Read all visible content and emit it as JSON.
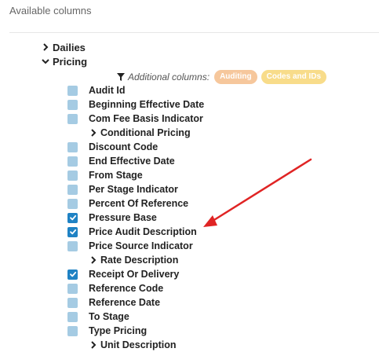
{
  "panel": {
    "title": "Available columns"
  },
  "groups": {
    "dailies": {
      "label": "Dailies"
    },
    "pricing": {
      "label": "Pricing"
    }
  },
  "additional": {
    "label": "Additional columns:",
    "pills": [
      "Auditing",
      "Codes and IDs"
    ]
  },
  "columns": [
    {
      "label": "Audit Id",
      "checked": false
    },
    {
      "label": "Beginning Effective Date",
      "checked": false
    },
    {
      "label": "Com Fee Basis Indicator",
      "checked": false
    },
    {
      "label": "Conditional Pricing",
      "expandable": true
    },
    {
      "label": "Discount Code",
      "checked": false
    },
    {
      "label": "End Effective Date",
      "checked": false
    },
    {
      "label": "From Stage",
      "checked": false
    },
    {
      "label": "Per Stage Indicator",
      "checked": false
    },
    {
      "label": "Percent Of Reference",
      "checked": false
    },
    {
      "label": "Pressure Base",
      "checked": true
    },
    {
      "label": "Price Audit Description",
      "checked": true
    },
    {
      "label": "Price Source Indicator",
      "checked": false
    },
    {
      "label": "Rate Description",
      "expandable": true
    },
    {
      "label": "Receipt Or Delivery",
      "checked": true
    },
    {
      "label": "Reference Code",
      "checked": false
    },
    {
      "label": "Reference Date",
      "checked": false
    },
    {
      "label": "To Stage",
      "checked": false
    },
    {
      "label": "Type Pricing",
      "checked": false
    },
    {
      "label": "Unit Description",
      "expandable": true
    }
  ],
  "colors": {
    "checkbox_checked": "#1f82c4",
    "checkbox_unchecked": "#a5cbe3",
    "pill_auditing": "#f6c79c",
    "pill_codes": "#f8dc8a",
    "annotation_arrow": "#e02424"
  }
}
